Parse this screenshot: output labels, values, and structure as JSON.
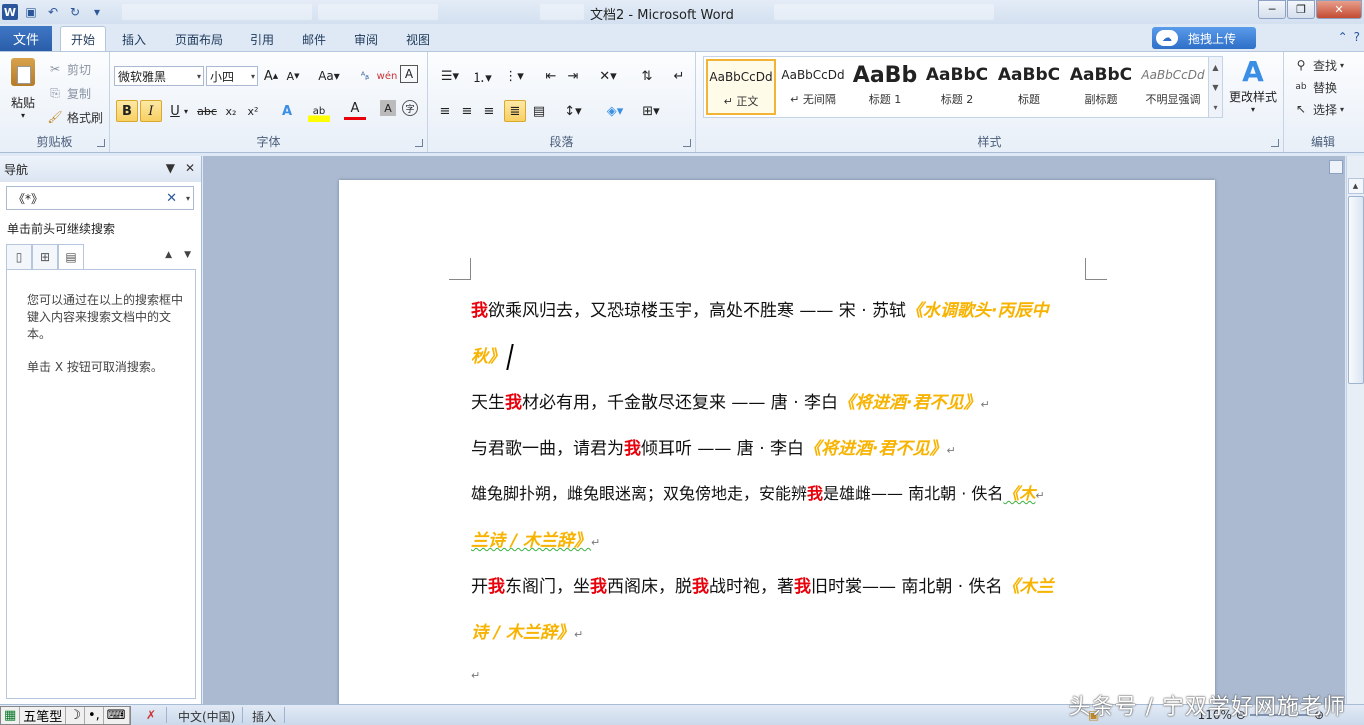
{
  "window": {
    "title": "文档2 - Microsoft Word"
  },
  "ribbon": {
    "file_tab": "文件",
    "tabs": [
      "开始",
      "插入",
      "页面布局",
      "引用",
      "邮件",
      "审阅",
      "视图"
    ],
    "cloud_upload": "拖拽上传",
    "clipboard": {
      "paste": "粘贴",
      "cut": "剪切",
      "copy": "复制",
      "format_painter": "格式刷",
      "label": "剪贴板"
    },
    "font": {
      "font_name": "微软雅黑",
      "font_size": "小四",
      "label": "字体"
    },
    "paragraph": {
      "label": "段落"
    },
    "styles": {
      "items": [
        {
          "preview": "AaBbCcDd",
          "name": "↵ 正文"
        },
        {
          "preview": "AaBbCcDd",
          "name": "↵ 无间隔"
        },
        {
          "preview": "AaBb",
          "name": "标题 1"
        },
        {
          "preview": "AaBbC",
          "name": "标题 2"
        },
        {
          "preview": "AaBbC",
          "name": "标题"
        },
        {
          "preview": "AaBbC",
          "name": "副标题"
        },
        {
          "preview": "AaBbCcDd",
          "name": "不明显强调"
        }
      ],
      "change_styles": "更改样式",
      "label": "样式"
    },
    "editing": {
      "find": "查找",
      "replace": "替换",
      "select": "选择",
      "label": "编辑"
    }
  },
  "nav_pane": {
    "title": "导航",
    "search_value": "《*》",
    "hint": "单击前头可继续搜索",
    "body_line1": "您可以通过在以上的搜索框中键入内容来搜索文档中的文本。",
    "body_line2": "单击 X 按钮可取消搜索。"
  },
  "document": {
    "p1": {
      "hl": "我",
      "text": "欲乘风归去，又恐琼楼玉宇，高处不胜寒 —— 宋 · 苏轼",
      "src_a": "《水调歌头·丙辰中",
      "src_b": "秋》"
    },
    "p2": {
      "pre": "天生",
      "hl": "我",
      "text": "材必有用，千金散尽还复来 —— 唐 · 李白",
      "src": "《将进酒·君不见》"
    },
    "p3": {
      "pre": "与君歌一曲，请君为",
      "hl": "我",
      "text": "倾耳听 —— 唐 · 李白",
      "src": "《将进酒·君不见》"
    },
    "p4": {
      "pre": "雄兔脚扑朔，雌兔眼迷离；双兔傍地走，安能辨",
      "hl": "我",
      "text": "是雄雌—— 南北朝 · 佚名",
      "src_a": "《木",
      "src_b": "兰诗 / 木兰辞》"
    },
    "p5": {
      "s1": "开",
      "h1": "我",
      "s2": "东阁门，坐",
      "h2": "我",
      "s3": "西阁床，脱",
      "h3": "我",
      "s4": "战时袍，著",
      "h4": "我",
      "s5": "旧时裳—— 南北朝 · 佚名",
      "src_a": "《木兰",
      "src_b": "诗 / 木兰辞》"
    }
  },
  "status": {
    "ime": "五笔型",
    "language": "中文(中国)",
    "mode": "插入",
    "zoom": "110%"
  },
  "watermark": "头条号 / 宁双学好网施老师"
}
